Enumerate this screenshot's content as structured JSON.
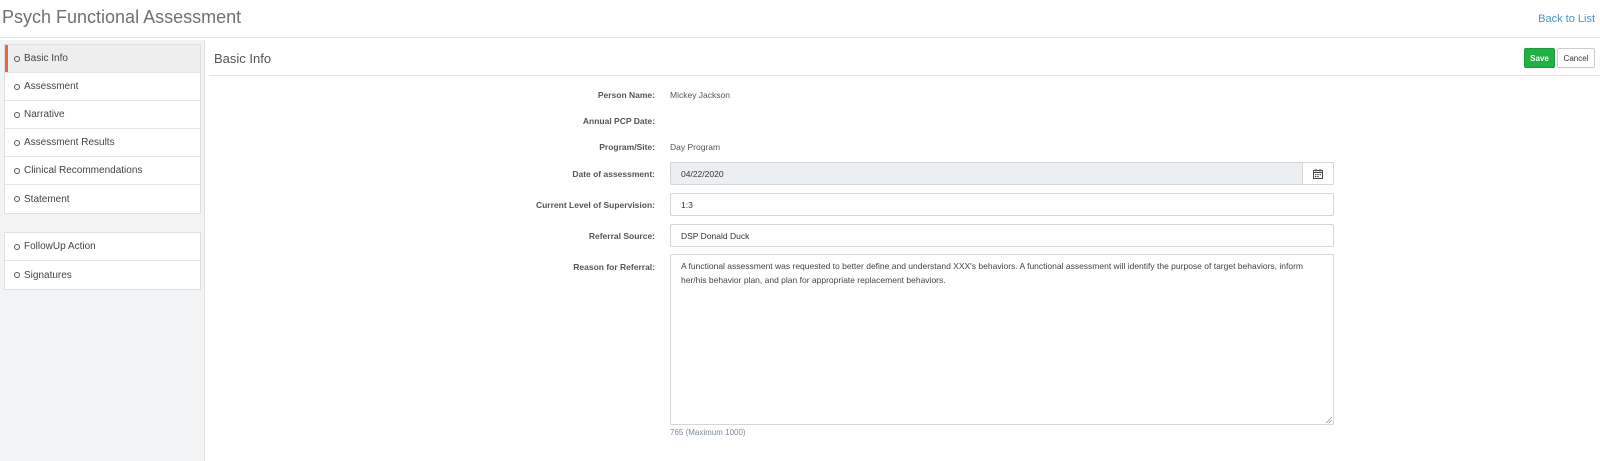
{
  "header": {
    "title": "Psych Functional Assessment",
    "back_link": "Back to List"
  },
  "sidebar": {
    "group1": [
      {
        "label": "Basic Info",
        "active": true
      },
      {
        "label": "Assessment"
      },
      {
        "label": "Narrative"
      },
      {
        "label": "Assessment Results"
      },
      {
        "label": "Clinical Recommendations"
      },
      {
        "label": "Statement"
      }
    ],
    "group2": [
      {
        "label": "FollowUp Action"
      },
      {
        "label": "Signatures"
      }
    ]
  },
  "main": {
    "section_title": "Basic Info",
    "save_label": "Save",
    "cancel_label": "Cancel",
    "fields": {
      "person_name": {
        "label": "Person Name:",
        "value": "Mickey Jackson"
      },
      "annual_pcp_date": {
        "label": "Annual PCP Date:",
        "value": ""
      },
      "program_site": {
        "label": "Program/Site:",
        "value": "Day Program"
      },
      "date_of_assessment": {
        "label": "Date of assessment:",
        "value": "04/22/2020"
      },
      "supervision": {
        "label": "Current Level of Supervision:",
        "value": "1:3"
      },
      "referral_source": {
        "label": "Referral Source:",
        "value": "DSP Donald Duck"
      },
      "reason": {
        "label": "Reason for Referral:",
        "value": "A functional assessment was requested to better define and understand XXX's behaviors. A functional assessment will identify the purpose of target behaviors, inform her/his behavior plan, and plan for appropriate replacement behaviors.",
        "char_count": "765 (Maximum 1000)"
      }
    }
  },
  "colors": {
    "accent": "#e8663d",
    "save": "#1fb141",
    "link": "#4a90d9"
  }
}
